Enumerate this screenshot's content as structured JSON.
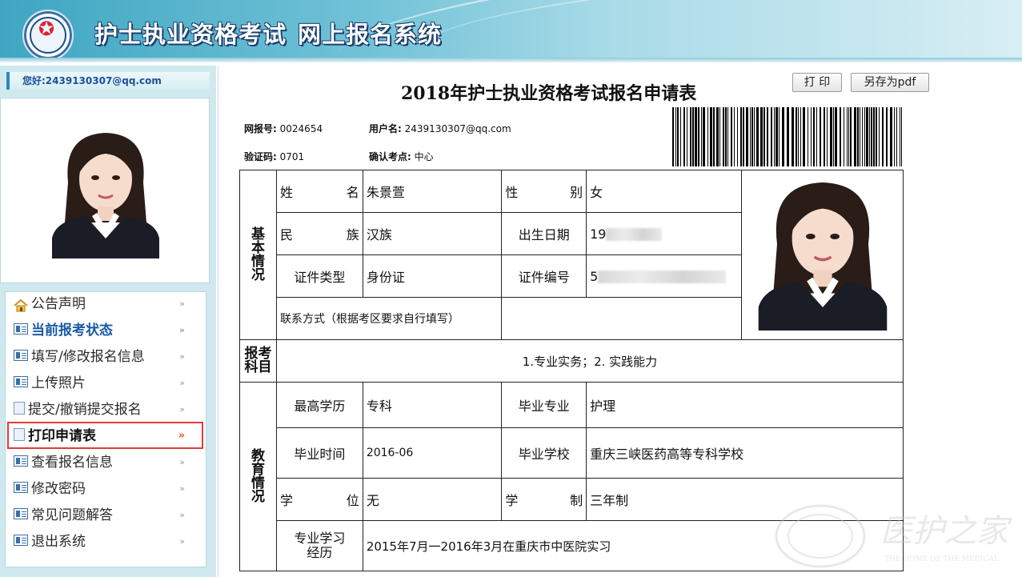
{
  "header": {
    "title_part1": "护士执业资格考试",
    "title_part2": "网上报名系统"
  },
  "sidebar": {
    "greeting": "您好:2439130307@qq.com",
    "menu": [
      {
        "label": "公告声明",
        "icon": "home-icon"
      },
      {
        "label": "当前报考状态",
        "icon": "card-icon"
      },
      {
        "label": "填写/修改报名信息",
        "icon": "card-icon"
      },
      {
        "label": "上传照片",
        "icon": "card-icon"
      },
      {
        "label": "提交/撤销提交报名",
        "icon": "document-icon"
      },
      {
        "label": "打印申请表",
        "icon": "document-icon"
      },
      {
        "label": "查看报名信息",
        "icon": "card-icon"
      },
      {
        "label": "修改密码",
        "icon": "card-icon"
      },
      {
        "label": "常见问题解答",
        "icon": "card-icon"
      },
      {
        "label": "退出系统",
        "icon": "card-icon"
      }
    ],
    "active_item": "打印申请表"
  },
  "main": {
    "doc_title": "2018年护士执业资格考试报名申请表",
    "print_button": "打 印",
    "save_pdf_button": "另存为pdf",
    "meta": {
      "net_no_label": "网报号:",
      "net_no": "0024654",
      "user_label": "用户名:",
      "user": "2439130307@qq.com",
      "verify_label": "验证码:",
      "verify": "0701",
      "site_label": "确认考点:",
      "site": "中心"
    },
    "form": {
      "basic_section": "基本情况",
      "name_label": "姓　　名",
      "name": "朱景萱",
      "gender_label": "性　　别",
      "gender": "女",
      "ethnic_label": "民　　族",
      "ethnic": "汉族",
      "birth_label": "出生日期",
      "birth_prefix": "19",
      "id_type_label": "证件类型",
      "id_type": "身份证",
      "id_no_label": "证件编号",
      "id_no_prefix": "5",
      "contact_label": "联系方式（根据考区要求自行填写）",
      "subject_section": "报考科目",
      "subjects": "1.专业实务；2. 实践能力",
      "edu_section": "教育情况",
      "edu_label": "最高学历",
      "edu": "专科",
      "major_label": "毕业专业",
      "major": "护理",
      "grad_time_label": "毕业时间",
      "grad_time": "2016-06",
      "school_label": "毕业学校",
      "school": "重庆三峡医药高等专科学校",
      "degree_label": "学　　位",
      "degree": "无",
      "system_label": "学　　制",
      "system": "三年制",
      "experience_label": "专业学习经历",
      "experience": "2015年7月一2016年3月在重庆市中医院实习"
    }
  },
  "watermark": {
    "text": "医护之家",
    "subtext": "THE HOME OF THE MEDICAL"
  },
  "colors": {
    "accent": "#2a89b8",
    "highlight": "#e23b3b"
  }
}
